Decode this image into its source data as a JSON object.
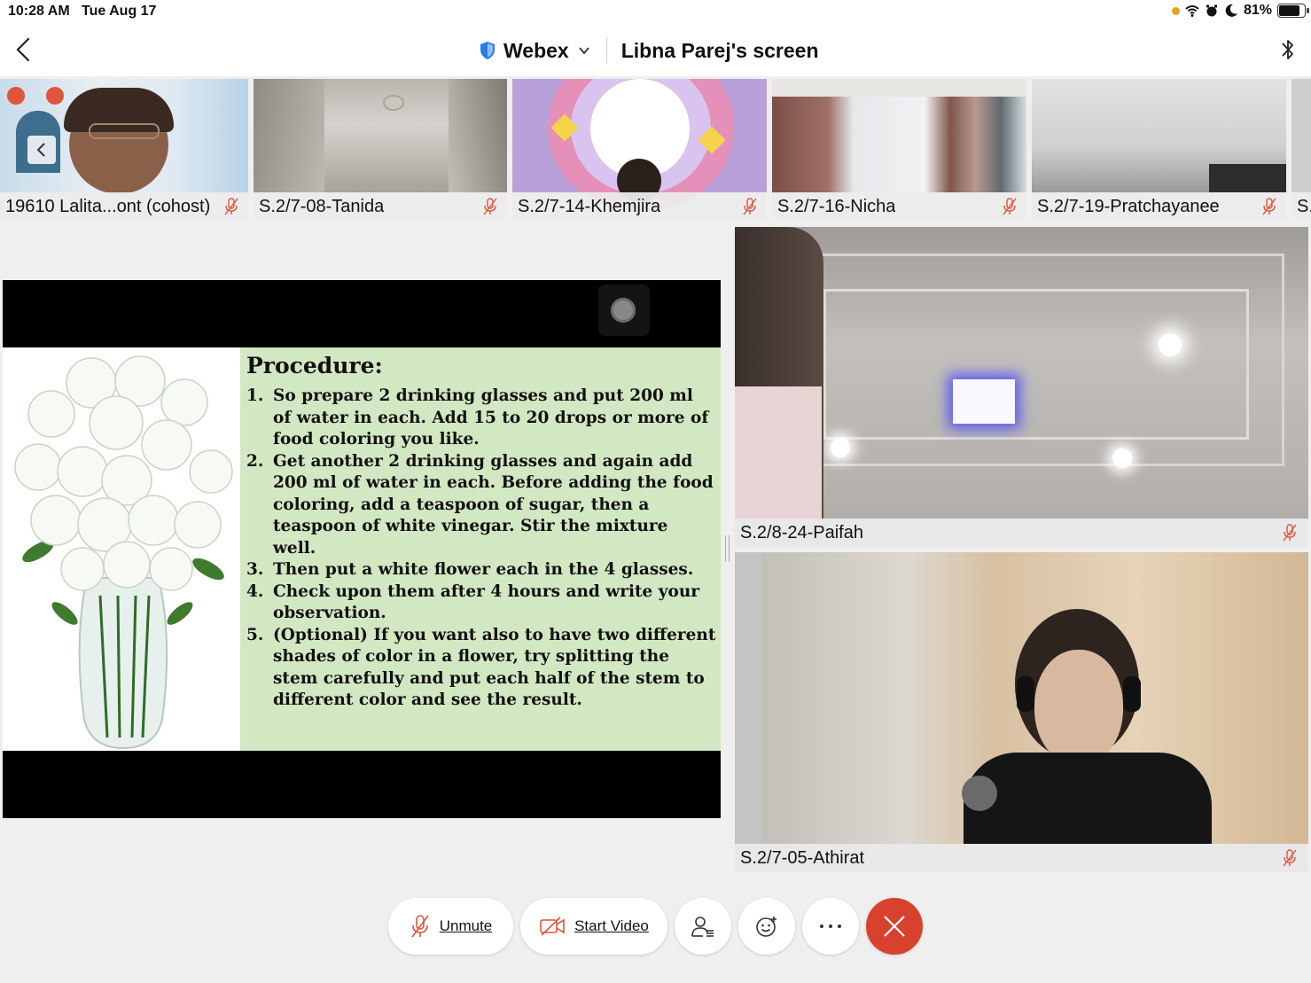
{
  "status_bar": {
    "time": "10:28 AM",
    "date": "Tue Aug 17",
    "battery": "81%",
    "battery_level": 0.81
  },
  "header": {
    "app_name": "Webex",
    "share_title": "Libna Parej's screen"
  },
  "thumbnails": [
    {
      "name": "19610 Lalita...ont (cohost)",
      "muted": true
    },
    {
      "name": "S.2/7-08-Tanida",
      "muted": true
    },
    {
      "name": "S.2/7-14-Khemjira",
      "muted": true
    },
    {
      "name": "S.2/7-16-Nicha",
      "muted": true
    },
    {
      "name": "S.2/7-19-Pratchayanee",
      "muted": true
    },
    {
      "name": "S.",
      "muted": false
    }
  ],
  "slide": {
    "heading": "Procedure:",
    "steps": [
      {
        "num": "1.",
        "text": "So prepare 2 drinking glasses and put 200 ml of water in each. Add 15 to 20 drops or more of food coloring you like."
      },
      {
        "num": "2.",
        "text": "Get another 2 drinking glasses and again add 200 ml of water in each. Before adding the food coloring, add a teaspoon of sugar, then a teaspoon of white vinegar. Stir the mixture well."
      },
      {
        "num": "3.",
        "text": "Then put a white flower each in the 4 glasses."
      },
      {
        "num": "4.",
        "text": "Check upon them after 4 hours and write your observation."
      },
      {
        "num": "5.",
        "text": "(Optional) If you want also to have two different shades of color in a flower, try splitting the stem carefully and put each half of the stem to different color and see the result."
      }
    ]
  },
  "tiles": [
    {
      "name": "S.2/8-24-Paifah",
      "muted": true
    },
    {
      "name": "S.2/7-05-Athirat",
      "muted": true
    }
  ],
  "controls": {
    "unmute_label": "Unmute",
    "start_video_label": "Start Video"
  },
  "colors": {
    "end_call": "#d9412f",
    "mic_muted": "#e0533c",
    "slide_bg": "#d2e8c2"
  }
}
